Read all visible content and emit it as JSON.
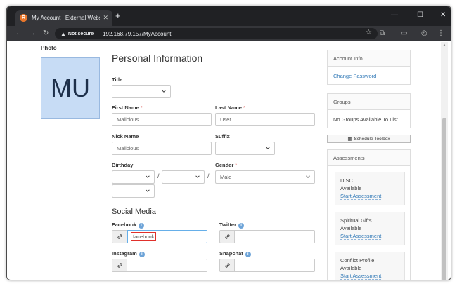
{
  "browser": {
    "tab_title": "My Account | External Website",
    "tab_favicon": "rock-favicon-icon",
    "new_tab": "+",
    "minimize": "—",
    "maximize": "☐",
    "close": "✕",
    "not_secure": "Not secure",
    "url": "192.168.79.157/MyAccount"
  },
  "photo": {
    "label": "Photo",
    "initials": "MU"
  },
  "personal": {
    "heading": "Personal Information",
    "title_label": "Title",
    "title_value": "",
    "first_name_label": "First Name",
    "first_name_value": "Malicious",
    "last_name_label": "Last Name",
    "last_name_value": "User",
    "nick_name_label": "Nick Name",
    "nick_name_value": "Malicious",
    "suffix_label": "Suffix",
    "suffix_value": "",
    "birthday_label": "Birthday",
    "date_separator": "/",
    "gender_label": "Gender",
    "gender_value": "Male",
    "required_mark": "*"
  },
  "social": {
    "heading": "Social Media",
    "facebook_label": "Facebook",
    "facebook_value": "facebook",
    "twitter_label": "Twitter",
    "twitter_value": "",
    "instagram_label": "Instagram",
    "instagram_value": "",
    "snapchat_label": "Snapchat",
    "snapchat_value": "",
    "info_glyph": "i"
  },
  "sidebar": {
    "account_info_heading": "Account Info",
    "change_password_link": "Change Password",
    "groups_heading": "Groups",
    "no_groups_text": "No Groups Available To List",
    "schedule_toolbox_button": "Schedule Toolbox",
    "assessments_heading": "Assessments",
    "assessments": [
      {
        "name": "DISC",
        "status": "Available",
        "link": "Start Assessment"
      },
      {
        "name": "Spiritual Gifts",
        "status": "Available",
        "link": "Start Assessment"
      },
      {
        "name": "Conflict Profile",
        "status": "Available",
        "link": "Start Assessment"
      }
    ]
  },
  "colors": {
    "link": "#337ab7",
    "avatar_bg": "#c7dcf5",
    "required": "#d9534f",
    "highlight": "#e0302b"
  }
}
